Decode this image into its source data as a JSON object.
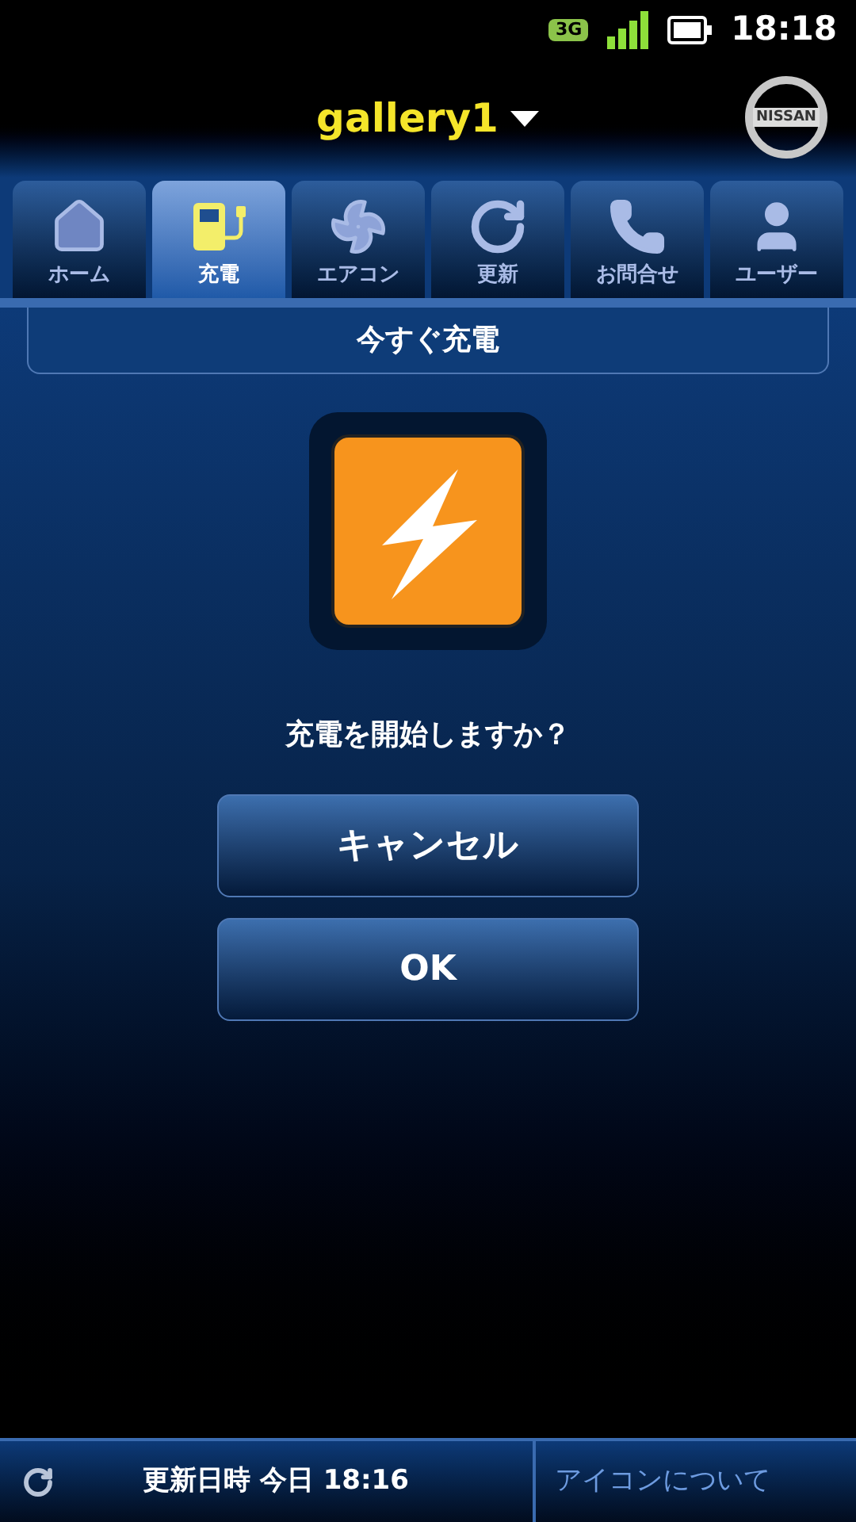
{
  "status_bar": {
    "network": "3G",
    "time": "18:18"
  },
  "header": {
    "title": "gallery1",
    "logo_text": "NISSAN"
  },
  "tabs": [
    {
      "label": "ホーム",
      "kind": "home",
      "selected": false
    },
    {
      "label": "充電",
      "kind": "charge",
      "selected": true
    },
    {
      "label": "エアコン",
      "kind": "fan",
      "selected": false
    },
    {
      "label": "更新",
      "kind": "refresh",
      "selected": false
    },
    {
      "label": "お問合せ",
      "kind": "phone",
      "selected": false
    },
    {
      "label": "ユーザー",
      "kind": "user",
      "selected": false
    }
  ],
  "section_title": "今すぐ充電",
  "prompt": "充電を開始しますか？",
  "buttons": [
    "キャンセル",
    "OK"
  ],
  "footer": {
    "updated": "更新日時 今日 18:16",
    "link": "アイコンについて"
  }
}
